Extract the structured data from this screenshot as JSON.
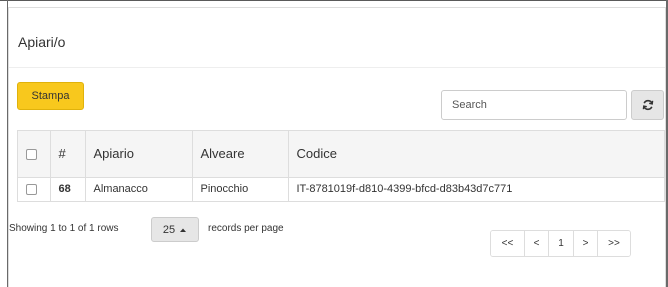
{
  "panel": {
    "title": "Apiari/o"
  },
  "toolbar": {
    "print_label": "Stampa",
    "search_placeholder": "Search"
  },
  "table": {
    "headers": {
      "number": "#",
      "apiario": "Apiario",
      "alveare": "Alveare",
      "codice": "Codice"
    },
    "rows": [
      {
        "number": "68",
        "apiario": "Almanacco",
        "alveare": "Pinocchio",
        "codice": "IT-8781019f-d810-4399-bfcd-d83b43d7c771"
      }
    ]
  },
  "footer": {
    "showing": "Showing 1 to 1 of 1 rows",
    "page_size": "25",
    "records_label": "records per page",
    "pager": {
      "first": "<<",
      "prev": "<",
      "current": "1",
      "next": ">",
      "last": ">>"
    }
  },
  "colors": {
    "accent": "#f8c81d",
    "border": "#dddddd",
    "header_bg": "#f5f5f5"
  },
  "icons": {
    "refresh": "refresh-icon",
    "caret": "caret-up-icon"
  }
}
